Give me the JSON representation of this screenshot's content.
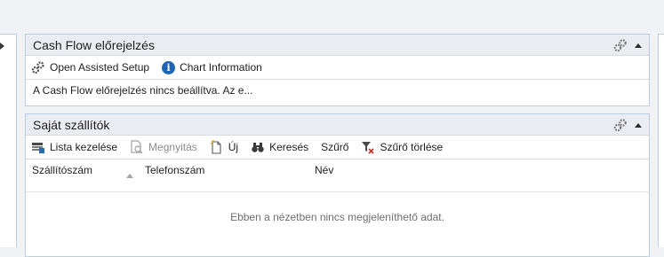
{
  "cash_flow_part": {
    "title": "Cash Flow előrejelzés",
    "actions": {
      "open_assisted_setup": "Open Assisted Setup",
      "chart_information": "Chart Information"
    },
    "message": "A Cash Flow előrejelzés nincs beállítva. Az e..."
  },
  "vendors_part": {
    "title": "Saját szállítók",
    "actions": {
      "manage_list": "Lista kezelése",
      "view": "Megnyitás",
      "new": "Új",
      "search": "Keresés",
      "filter": "Szűrő",
      "clear_filter": "Szűrő törlése"
    },
    "columns": [
      "Szállítószám",
      "Telefonszám",
      "Név"
    ],
    "empty_message": "Ebben a nézetben nincs megjeleníthető adat."
  },
  "icons": {
    "settings": "gear-icon",
    "collapse": "chevron-up-icon",
    "info": "info-icon",
    "sort": "sort-ascending-icon",
    "filter_clear": "filter-clear-icon"
  },
  "colors": {
    "border": "#b9cde6",
    "header_bg": "#e9ecf0",
    "info_blue": "#1e64b4",
    "clear_red": "#d0342c"
  }
}
